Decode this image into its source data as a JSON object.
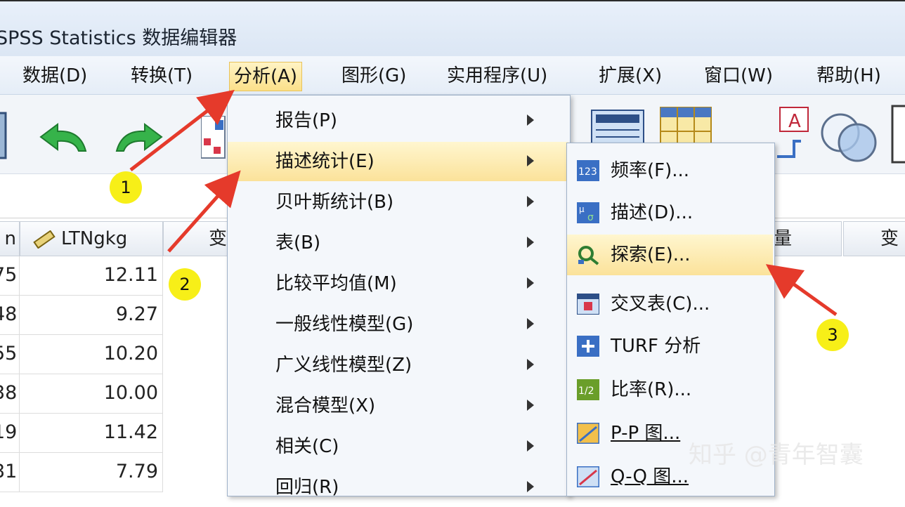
{
  "window": {
    "title": "SPSS Statistics 数据编辑器"
  },
  "menubar": [
    {
      "label": "数据(D)"
    },
    {
      "label": "转换(T)"
    },
    {
      "label": "分析(A)"
    },
    {
      "label": "图形(G)"
    },
    {
      "label": "实用程序(U)"
    },
    {
      "label": "扩展(X)"
    },
    {
      "label": "窗口(W)"
    },
    {
      "label": "帮助(H)"
    }
  ],
  "grid": {
    "headers": [
      "n",
      "LTNgkg",
      "变",
      "量",
      "变"
    ],
    "left_col": [
      "75",
      "48",
      "55",
      "38",
      "19",
      "31"
    ],
    "ltngkg": [
      "12.11",
      "9.27",
      "10.20",
      "10.00",
      "11.42",
      "7.79"
    ]
  },
  "analyze_menu": [
    {
      "label": "报告(P)"
    },
    {
      "label": "描述统计(E)"
    },
    {
      "label": "贝叶斯统计(B)"
    },
    {
      "label": "表(B)"
    },
    {
      "label": "比较平均值(M)"
    },
    {
      "label": "一般线性模型(G)"
    },
    {
      "label": "广义线性模型(Z)"
    },
    {
      "label": "混合模型(X)"
    },
    {
      "label": "相关(C)"
    },
    {
      "label": "回归(R)"
    }
  ],
  "descriptive_submenu": [
    {
      "label": "频率(F)...",
      "icon": "frequency-icon"
    },
    {
      "label": "描述(D)...",
      "icon": "descriptives-icon"
    },
    {
      "label": "探索(E)...",
      "icon": "explore-icon"
    },
    {
      "label": "交叉表(C)...",
      "icon": "crosstabs-icon"
    },
    {
      "label": "TURF 分析",
      "icon": "turf-icon"
    },
    {
      "label": "比率(R)...",
      "icon": "ratio-icon"
    },
    {
      "label": "P-P 图...",
      "icon": "pp-plot-icon"
    },
    {
      "label": "Q-Q 图...",
      "icon": "qq-plot-icon"
    }
  ],
  "annotations": {
    "badge1": "1",
    "badge2": "2",
    "badge3": "3"
  },
  "watermark": "知乎 @青年智囊",
  "colors": {
    "highlight": "#fbe29a",
    "badge": "#f7ef18",
    "arrow": "#e53a2b"
  }
}
